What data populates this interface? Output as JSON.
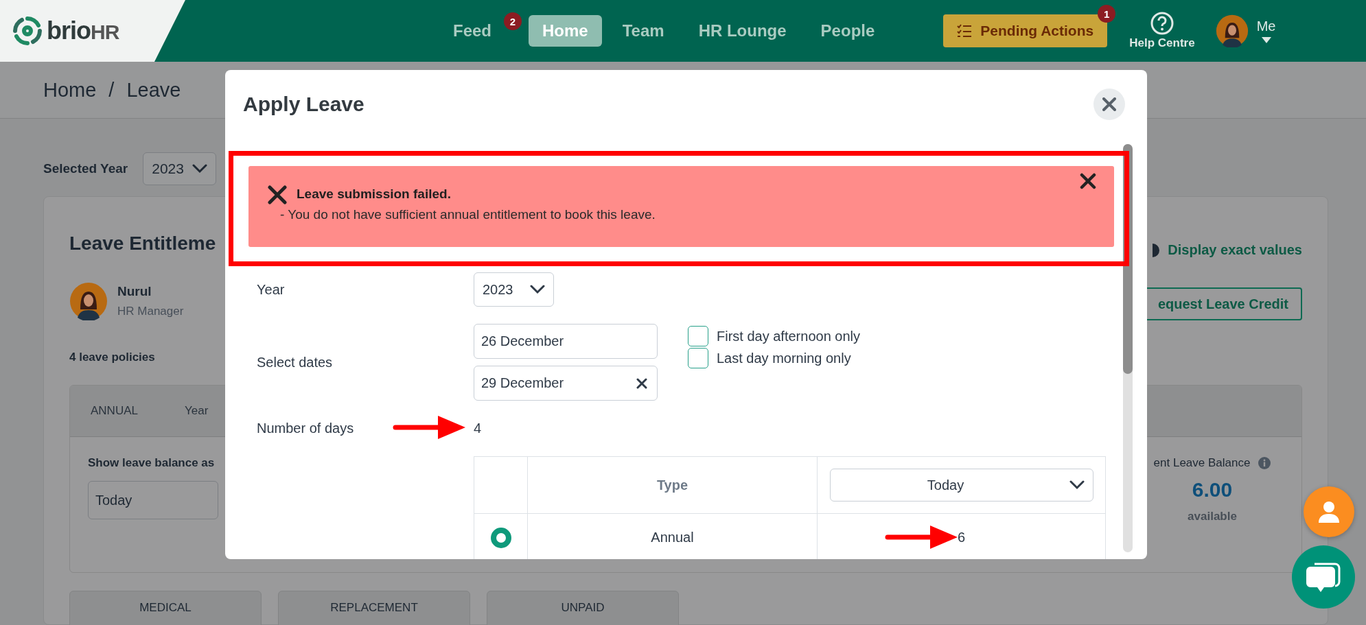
{
  "header": {
    "logo": {
      "part_1": "brio",
      "part_2": "HR"
    },
    "nav": [
      {
        "label": "Feed",
        "badge": "2",
        "selected": false
      },
      {
        "label": "Home",
        "selected": true
      },
      {
        "label": "Team",
        "selected": false
      },
      {
        "label": "HR Lounge",
        "selected": false
      },
      {
        "label": "People",
        "selected": false
      }
    ],
    "pending_actions": {
      "label": "Pending Actions",
      "badge": "1"
    },
    "help": {
      "label": "Help Centre"
    },
    "user": {
      "label": "Me"
    }
  },
  "breadcrumb": {
    "items": [
      "Home",
      "Leave"
    ],
    "separator": "/"
  },
  "selected_year": {
    "label": "Selected Year",
    "value": "2023"
  },
  "entitlement": {
    "title": "Leave Entitleme",
    "display_link": "Display exact values",
    "request_button": "equest Leave Credit",
    "employee": {
      "name": "Nurul",
      "role": "HR Manager"
    },
    "policy_count": "4 leave policies",
    "panel_tabs": [
      "ANNUAL",
      "Year"
    ],
    "balance_as": {
      "label": "Show leave balance as",
      "value": "Today"
    },
    "balance": {
      "label": "ent Leave Balance",
      "value": "6.00",
      "caption": "available"
    },
    "other_policies": [
      "MEDICAL",
      "REPLACEMENT",
      "UNPAID"
    ]
  },
  "dialog": {
    "title": "Apply Leave",
    "alert": {
      "title": "Leave submission failed.",
      "message": "- You do not have sufficient annual entitlement to book this leave."
    },
    "year": {
      "label": "Year",
      "value": "2023"
    },
    "dates": {
      "label": "Select dates",
      "start": "26 December",
      "end": "29 December"
    },
    "options": [
      {
        "label": "First day afternoon only",
        "checked": false
      },
      {
        "label": "Last day morning only",
        "checked": false
      }
    ],
    "days": {
      "label": "Number of days",
      "value": "4"
    },
    "table": {
      "columns": [
        "Type"
      ],
      "date_select": "Today",
      "rows": [
        {
          "type": "Annual",
          "balance": "6",
          "selected": true
        }
      ]
    }
  }
}
